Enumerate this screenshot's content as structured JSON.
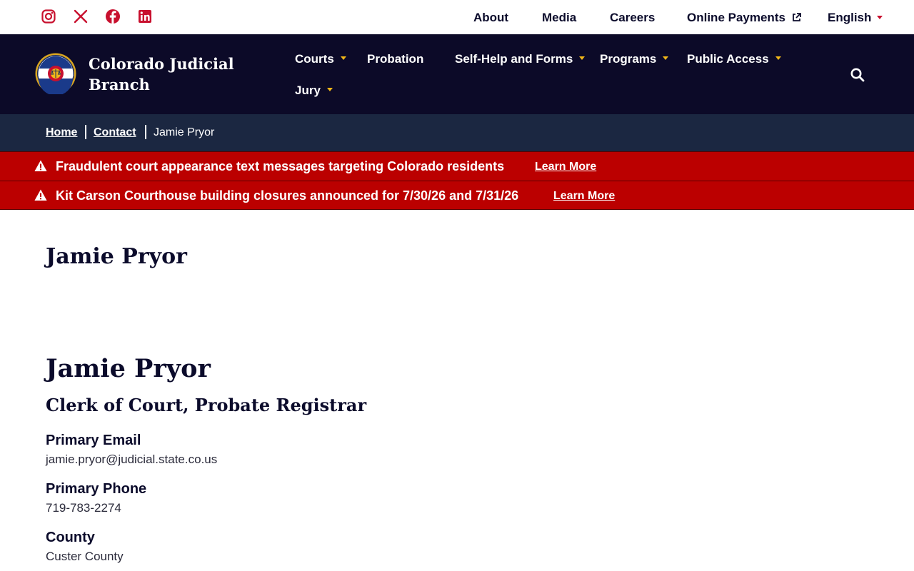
{
  "social": {
    "icons": [
      "instagram-icon",
      "x-icon",
      "facebook-icon",
      "linkedin-icon"
    ],
    "color": "#c8102e"
  },
  "utility_nav": {
    "about": "About",
    "media": "Media",
    "careers": "Careers",
    "online_payments": "Online Payments",
    "language": "English"
  },
  "brand": {
    "name": "Colorado Judicial Branch",
    "seal_text_top": "COLORADO",
    "seal_text_bottom": "COURTS"
  },
  "main_nav": {
    "items": [
      {
        "label": "Courts",
        "has_dropdown": true
      },
      {
        "label": "Probation",
        "has_dropdown": false
      },
      {
        "label": "Self-Help and Forms",
        "has_dropdown": true
      },
      {
        "label": "Programs",
        "has_dropdown": true
      },
      {
        "label": "Public Access",
        "has_dropdown": true
      },
      {
        "label": "Jury",
        "has_dropdown": true
      }
    ],
    "search_icon": "search-icon"
  },
  "breadcrumb": {
    "home": "Home",
    "contact": "Contact",
    "current": "Jamie Pryor"
  },
  "alerts": [
    {
      "text": "Fraudulent court appearance text messages targeting Colorado residents",
      "link": "Learn More"
    },
    {
      "text": "Kit Carson Courthouse building closures announced for 7/30/26 and 7/31/26",
      "link": "Learn More"
    }
  ],
  "page": {
    "title": "Jamie Pryor"
  },
  "profile": {
    "name": "Jamie Pryor",
    "position": "Clerk of Court, Probate Registrar",
    "email_label": "Primary Email",
    "email": "jamie.pryor@judicial.state.co.us",
    "phone_label": "Primary Phone",
    "phone": "719-783-2274",
    "county_label": "County",
    "county": "Custer County"
  },
  "colors": {
    "nav_bg": "#0c0a28",
    "breadcrumb_bg": "#1b2741",
    "alert_bg": "#bb0000",
    "accent_gold": "#f2b718",
    "accent_red": "#c8102e"
  }
}
